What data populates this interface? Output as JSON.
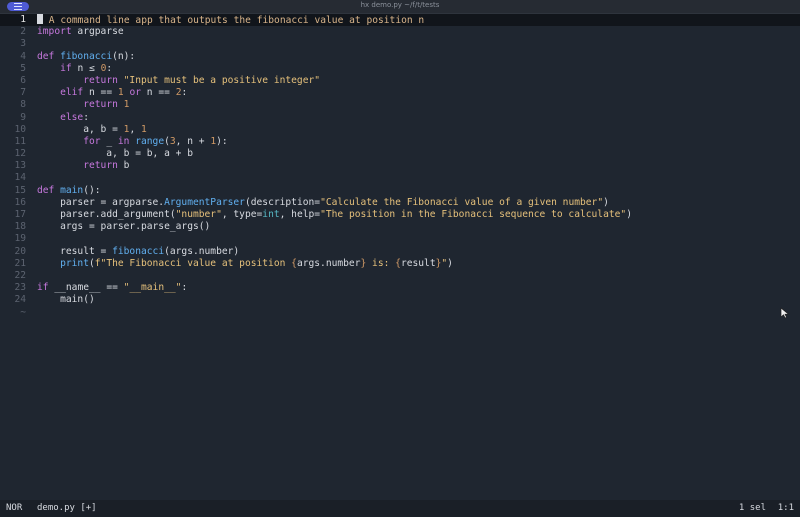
{
  "window": {
    "title": "hx demo.py ~/f/t/tests",
    "menu_icon": "menu-icon"
  },
  "editor": {
    "current_line": 1,
    "lines": [
      {
        "n": "1",
        "tokens": [
          [
            "cursor",
            ""
          ],
          [
            "comment",
            " A command line app that outputs the fibonacci value at position n"
          ]
        ]
      },
      {
        "n": "2",
        "tokens": [
          [
            "kw",
            "import"
          ],
          [
            "id",
            " argparse"
          ]
        ]
      },
      {
        "n": "3",
        "tokens": []
      },
      {
        "n": "4",
        "tokens": [
          [
            "kw",
            "def"
          ],
          [
            "id",
            " "
          ],
          [
            "fn",
            "fibonacci"
          ],
          [
            "op",
            "(n):"
          ]
        ]
      },
      {
        "n": "5",
        "tokens": [
          [
            "id",
            "    "
          ],
          [
            "kw",
            "if"
          ],
          [
            "id",
            " n "
          ],
          [
            "op",
            "≤"
          ],
          [
            "id",
            " "
          ],
          [
            "num",
            "0"
          ],
          [
            "op",
            ":"
          ]
        ]
      },
      {
        "n": "6",
        "tokens": [
          [
            "id",
            "        "
          ],
          [
            "kw",
            "return"
          ],
          [
            "id",
            " "
          ],
          [
            "str",
            "\"Input must be a positive integer\""
          ]
        ]
      },
      {
        "n": "7",
        "tokens": [
          [
            "id",
            "    "
          ],
          [
            "kw",
            "elif"
          ],
          [
            "id",
            " n "
          ],
          [
            "op",
            "=="
          ],
          [
            "id",
            " "
          ],
          [
            "num",
            "1"
          ],
          [
            "id",
            " "
          ],
          [
            "kw",
            "or"
          ],
          [
            "id",
            " n "
          ],
          [
            "op",
            "=="
          ],
          [
            "id",
            " "
          ],
          [
            "num",
            "2"
          ],
          [
            "op",
            ":"
          ]
        ]
      },
      {
        "n": "8",
        "tokens": [
          [
            "id",
            "        "
          ],
          [
            "kw",
            "return"
          ],
          [
            "id",
            " "
          ],
          [
            "num",
            "1"
          ]
        ]
      },
      {
        "n": "9",
        "tokens": [
          [
            "id",
            "    "
          ],
          [
            "kw",
            "else"
          ],
          [
            "op",
            ":"
          ]
        ]
      },
      {
        "n": "10",
        "tokens": [
          [
            "id",
            "        a, b "
          ],
          [
            "op",
            "="
          ],
          [
            "id",
            " "
          ],
          [
            "num",
            "1"
          ],
          [
            "id",
            ", "
          ],
          [
            "num",
            "1"
          ]
        ]
      },
      {
        "n": "11",
        "tokens": [
          [
            "id",
            "        "
          ],
          [
            "kw",
            "for"
          ],
          [
            "id",
            " _ "
          ],
          [
            "kw",
            "in"
          ],
          [
            "id",
            " "
          ],
          [
            "fn",
            "range"
          ],
          [
            "op",
            "("
          ],
          [
            "num",
            "3"
          ],
          [
            "id",
            ", n "
          ],
          [
            "op",
            "+"
          ],
          [
            "id",
            " "
          ],
          [
            "num",
            "1"
          ],
          [
            "op",
            "):"
          ]
        ]
      },
      {
        "n": "12",
        "tokens": [
          [
            "id",
            "            a, b "
          ],
          [
            "op",
            "="
          ],
          [
            "id",
            " b, a "
          ],
          [
            "op",
            "+"
          ],
          [
            "id",
            " b"
          ]
        ]
      },
      {
        "n": "13",
        "tokens": [
          [
            "id",
            "        "
          ],
          [
            "kw",
            "return"
          ],
          [
            "id",
            " b"
          ]
        ]
      },
      {
        "n": "14",
        "tokens": []
      },
      {
        "n": "15",
        "tokens": [
          [
            "kw",
            "def"
          ],
          [
            "id",
            " "
          ],
          [
            "fn",
            "main"
          ],
          [
            "op",
            "():"
          ]
        ]
      },
      {
        "n": "16",
        "tokens": [
          [
            "id",
            "    parser "
          ],
          [
            "op",
            "="
          ],
          [
            "id",
            " argparse."
          ],
          [
            "fn",
            "ArgumentParser"
          ],
          [
            "op",
            "("
          ],
          [
            "id",
            "description"
          ],
          [
            "op",
            "="
          ],
          [
            "str",
            "\"Calculate the Fibonacci value of a given number\""
          ],
          [
            "op",
            ")"
          ]
        ]
      },
      {
        "n": "17",
        "tokens": [
          [
            "id",
            "    parser."
          ],
          [
            "id",
            "add_argument"
          ],
          [
            "op",
            "("
          ],
          [
            "str",
            "\"number\""
          ],
          [
            "id",
            ", type"
          ],
          [
            "op",
            "="
          ],
          [
            "builtin",
            "int"
          ],
          [
            "id",
            ", help"
          ],
          [
            "op",
            "="
          ],
          [
            "str",
            "\"The position in the Fibonacci sequence to calculate\""
          ],
          [
            "op",
            ")"
          ]
        ]
      },
      {
        "n": "18",
        "tokens": [
          [
            "id",
            "    args "
          ],
          [
            "op",
            "="
          ],
          [
            "id",
            " parser."
          ],
          [
            "id",
            "parse_args"
          ],
          [
            "op",
            "()"
          ]
        ]
      },
      {
        "n": "19",
        "tokens": []
      },
      {
        "n": "20",
        "tokens": [
          [
            "id",
            "    result "
          ],
          [
            "op",
            "="
          ],
          [
            "id",
            " "
          ],
          [
            "fn",
            "fibonacci"
          ],
          [
            "op",
            "("
          ],
          [
            "id",
            "args.number"
          ],
          [
            "op",
            ")"
          ]
        ]
      },
      {
        "n": "21",
        "tokens": [
          [
            "id",
            "    "
          ],
          [
            "fn",
            "print"
          ],
          [
            "op",
            "("
          ],
          [
            "str",
            "f\"The Fibonacci value at position "
          ],
          [
            "kw2",
            "{"
          ],
          [
            "id",
            "args.number"
          ],
          [
            "kw2",
            "}"
          ],
          [
            "str",
            " is: "
          ],
          [
            "kw2",
            "{"
          ],
          [
            "id",
            "result"
          ],
          [
            "kw2",
            "}"
          ],
          [
            "str",
            "\""
          ],
          [
            "op",
            ")"
          ]
        ]
      },
      {
        "n": "22",
        "tokens": []
      },
      {
        "n": "23",
        "tokens": [
          [
            "kw",
            "if"
          ],
          [
            "id",
            " __name__ "
          ],
          [
            "op",
            "=="
          ],
          [
            "id",
            " "
          ],
          [
            "str",
            "\"__main__\""
          ],
          [
            "op",
            ":"
          ]
        ]
      },
      {
        "n": "24",
        "tokens": [
          [
            "id",
            "    main"
          ],
          [
            "op",
            "()"
          ]
        ]
      },
      {
        "n": "~",
        "tokens": []
      }
    ]
  },
  "statusbar": {
    "mode": "NOR",
    "file": "demo.py [+]",
    "selection": "1 sel",
    "position": "1:1"
  },
  "colors": {
    "background": "#1f2630",
    "keyword": "#c678dd",
    "function": "#61afef",
    "string": "#e5c07b",
    "number": "#d19a66",
    "comment": "#d8b48a"
  }
}
